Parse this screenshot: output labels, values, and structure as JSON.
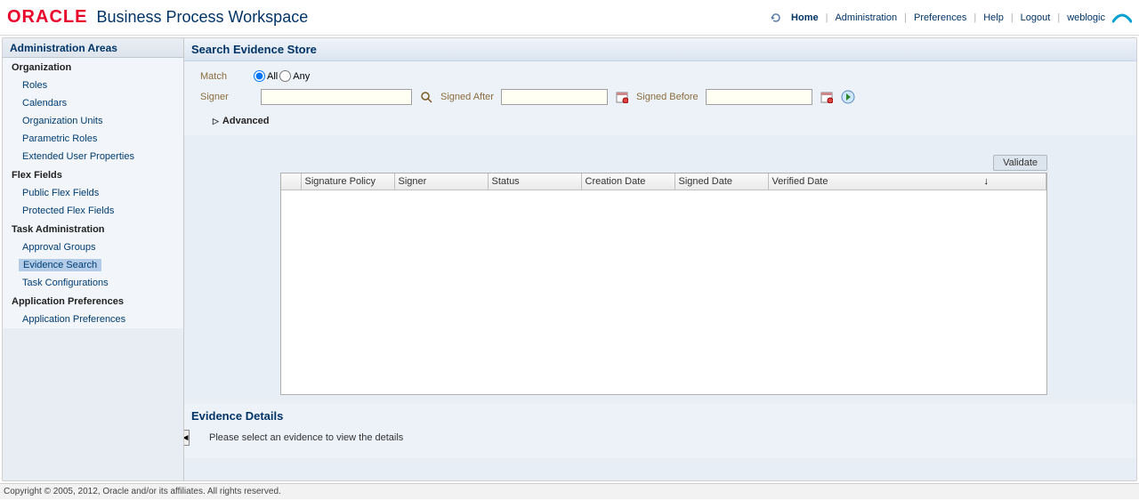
{
  "header": {
    "logo": "ORACLE",
    "app_title": "Business Process Workspace",
    "links": {
      "home": "Home",
      "administration": "Administration",
      "preferences": "Preferences",
      "help": "Help",
      "logout": "Logout",
      "user": "weblogic"
    }
  },
  "sidebar": {
    "title": "Administration Areas",
    "groups": [
      {
        "label": "Organization",
        "items": [
          {
            "label": "Roles"
          },
          {
            "label": "Calendars"
          },
          {
            "label": "Organization Units"
          },
          {
            "label": "Parametric Roles"
          },
          {
            "label": "Extended User Properties"
          }
        ]
      },
      {
        "label": "Flex Fields",
        "items": [
          {
            "label": "Public Flex Fields"
          },
          {
            "label": "Protected Flex Fields"
          }
        ]
      },
      {
        "label": "Task Administration",
        "items": [
          {
            "label": "Approval Groups"
          },
          {
            "label": "Evidence Search",
            "selected": true
          },
          {
            "label": "Task Configurations"
          }
        ]
      },
      {
        "label": "Application Preferences",
        "items": [
          {
            "label": "Application Preferences"
          }
        ]
      }
    ]
  },
  "main": {
    "search_panel_title": "Search Evidence Store",
    "form": {
      "match_label": "Match",
      "match_all": "All",
      "match_any": "Any",
      "match_value": "All",
      "signer_label": "Signer",
      "signer_value": "",
      "signed_after_label": "Signed After",
      "signed_after_value": "",
      "signed_before_label": "Signed Before",
      "signed_before_value": "",
      "advanced_label": "Advanced"
    },
    "validate_label": "Validate",
    "columns": {
      "c0": "",
      "c1": "Signature Policy",
      "c2": "Signer",
      "c3": "Status",
      "c4": "Creation Date",
      "c5": "Signed Date",
      "c6": "Verified Date"
    },
    "details_title": "Evidence Details",
    "details_msg": "Please select an evidence to view the details"
  },
  "footer": {
    "copyright": "Copyright © 2005, 2012, Oracle and/or its affiliates. All rights reserved."
  }
}
